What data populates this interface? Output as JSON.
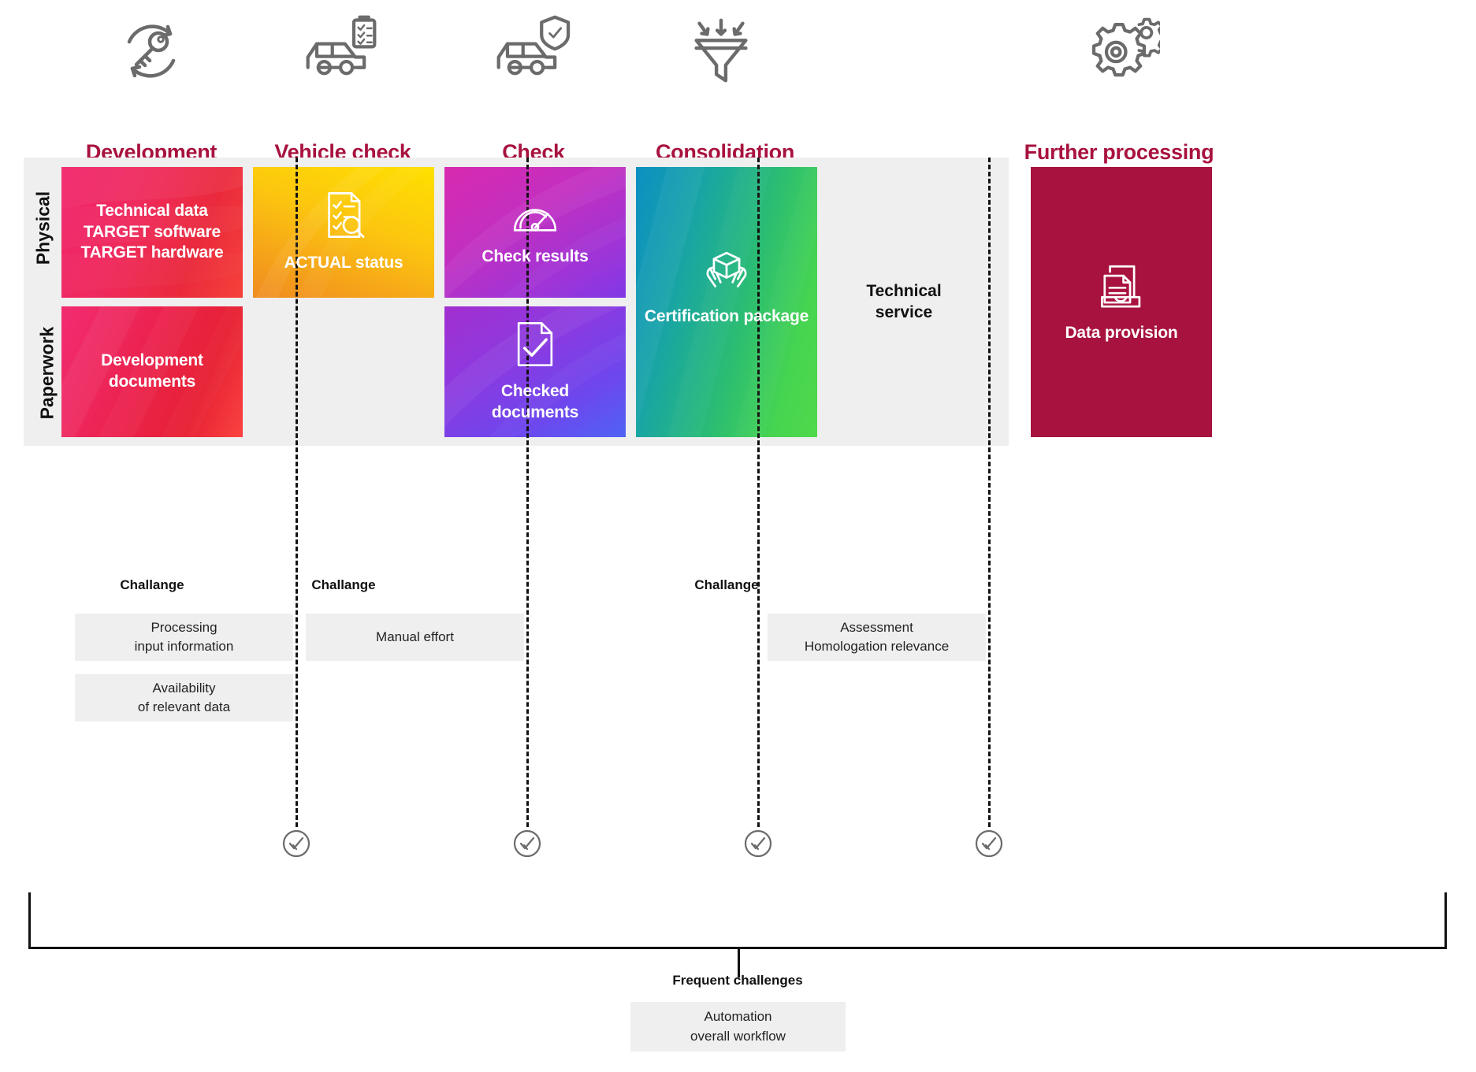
{
  "phases": [
    {
      "id": "development",
      "title": "Development",
      "icon": "key-refresh-icon"
    },
    {
      "id": "vehicle-check",
      "title": "Vehicle check",
      "icon": "car-clipboard-icon"
    },
    {
      "id": "check",
      "title": "Check",
      "icon": "car-shield-icon"
    },
    {
      "id": "consolidation",
      "title": "Consolidation",
      "icon": "funnel-icon"
    },
    {
      "id": "further-processing",
      "title": "Further processing",
      "icon": "gears-icon"
    }
  ],
  "rows": [
    {
      "id": "physical",
      "label": "Physical"
    },
    {
      "id": "paperwork",
      "label": "Paperwork"
    }
  ],
  "tiles": {
    "technical_data": {
      "label": "Technical data\nTARGET software\nTARGET hardware",
      "icon": "none",
      "color": "#ef2a5d"
    },
    "development_docs": {
      "label": "Development\ndocuments",
      "icon": "none",
      "color": "#ec2352"
    },
    "actual_status": {
      "label": "ACTUAL status",
      "icon": "document-search-icon",
      "color": "#f5a11a"
    },
    "check_results": {
      "label": "Check results",
      "icon": "gauge-icon",
      "color": "#9c35d9"
    },
    "checked_documents": {
      "label": "Checked\ndocuments",
      "icon": "document-check-icon",
      "color": "#6d47ee"
    },
    "certification_package": {
      "label": "Certification package",
      "icon": "package-hands-icon",
      "color": "#2bbd72"
    },
    "data_provision": {
      "label": "Data provision",
      "icon": "documents-tray-icon",
      "color": "#a8123e"
    }
  },
  "technical_service": {
    "label": "Technical\nservice"
  },
  "challenges": [
    {
      "phase": "development",
      "heading": "Challange",
      "items": [
        "Processing\ninput information",
        "Availability\nof relevant data"
      ]
    },
    {
      "phase": "vehicle-check",
      "heading": "Challange",
      "items": [
        "Manual effort"
      ]
    },
    {
      "phase": "consolidation",
      "heading": "Challange",
      "items": [
        "Assessment\nHomologation relevance"
      ]
    }
  ],
  "check_badges": [
    {
      "id": "check-badge-1",
      "icon": "circle-check-icon"
    },
    {
      "id": "check-badge-2",
      "icon": "circle-check-icon"
    },
    {
      "id": "check-badge-3",
      "icon": "circle-check-icon"
    },
    {
      "id": "check-badge-4",
      "icon": "circle-check-icon"
    }
  ],
  "bottom": {
    "heading": "Frequent challenges",
    "items": [
      "Automation\noverall workflow"
    ]
  },
  "colors": {
    "accent": "#a8123e",
    "panel": "#efefef",
    "text": "#111111",
    "icon_stroke": "#6b6b6b"
  }
}
